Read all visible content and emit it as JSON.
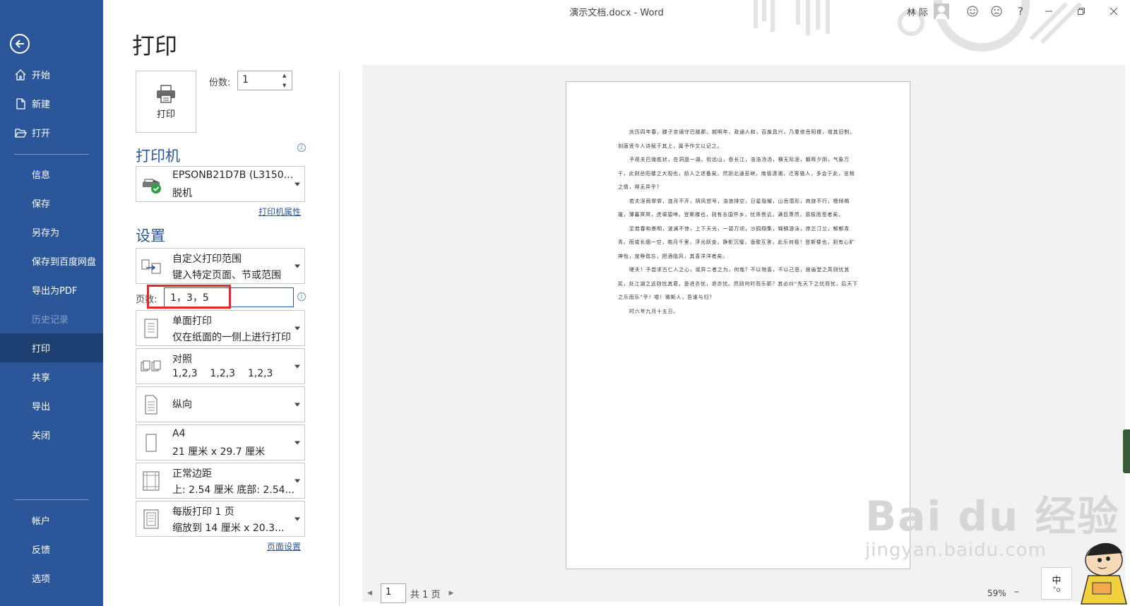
{
  "window": {
    "doc_title": "演示文档.docx  -  Word",
    "user_name": "林 际",
    "help_label": "?",
    "colors": {
      "sidebar": "#2b579a",
      "sidebar_active": "#1e3f72",
      "accent": "#2b579a",
      "highlight": "#e6262d"
    }
  },
  "sidebar": {
    "items": [
      {
        "label": "开始",
        "icon": "home-icon"
      },
      {
        "label": "新建",
        "icon": "new-document-icon"
      },
      {
        "label": "打开",
        "icon": "folder-open-icon"
      },
      {
        "label": "信息"
      },
      {
        "label": "保存"
      },
      {
        "label": "另存为"
      },
      {
        "label": "保存到百度网盘"
      },
      {
        "label": "导出为PDF"
      },
      {
        "label": "历史记录",
        "disabled": true
      },
      {
        "label": "打印",
        "active": true
      },
      {
        "label": "共享"
      },
      {
        "label": "导出"
      },
      {
        "label": "关闭"
      },
      {
        "label": "帐户"
      },
      {
        "label": "反馈"
      },
      {
        "label": "选项"
      }
    ]
  },
  "print": {
    "title": "打印",
    "button_label": "打印",
    "copies_label": "份数:",
    "copies_value": "1"
  },
  "printer": {
    "section_title": "打印机",
    "name": "EPSONB21D7B (L3150...",
    "status": "脱机",
    "properties_link": "打印机属性"
  },
  "settings": {
    "section_title": "设置",
    "range": {
      "line1": "自定义打印范围",
      "line2": "键入特定页面、节或范围"
    },
    "pages_label": "页数:",
    "pages_value": "1，3，5",
    "sides": {
      "line1": "单面打印",
      "line2": "仅在纸面的一侧上进行打印"
    },
    "collate": {
      "line1": "对照",
      "line2": "1,2,3    1,2,3    1,2,3"
    },
    "orientation": {
      "line1": "纵向"
    },
    "paper": {
      "line1": "A4",
      "line2": "21 厘米 x 29.7 厘米"
    },
    "margins": {
      "line1": "正常边距",
      "line2": "上: 2.54 厘米 底部: 2.54..."
    },
    "pages_per_sheet": {
      "line1": "每版打印 1 页",
      "line2": "缩放到 14 厘米 x 20.3..."
    },
    "page_setup_link": "页面设置"
  },
  "preview": {
    "paragraphs": [
      "庆历四年春，滕子京谪守巴陵郡。越明年，政通人和，百废具兴，乃重修岳阳楼，增其旧制，刻唐贤今人诗赋于其上，属予作文以记之。",
      "予观夫巴陵胜状，在洞庭一湖。衔远山，吞长江，浩浩汤汤，横无际涯，朝晖夕阴，气象万千，此则岳阳楼之大观也，前人之述备矣。然则北通巫峡，南极潇湘，迁客骚人，多会于此，览物之情，得无异乎？",
      "若夫淫雨霏霏，连月不开，阴风怒号，浊浪排空，日星隐耀，山岳潜形，商旅不行，樯倾楫摧，薄暮冥冥，虎啸猿啼。登斯楼也，则有去国怀乡，忧谗畏讥，满目萧然，感极而悲者矣。",
      "至若春和景明，波澜不惊，上下天光，一碧万顷，沙鸥翔集，锦鳞游泳，岸芷汀兰，郁郁青青。而或长烟一空，皓月千里，浮光跃金，静影沉璧，渔歌互答，此乐何极！登斯楼也，则有心旷神怡，宠辱偕忘，把酒临风，其喜洋洋者矣。",
      "嗟夫！予尝求古仁人之心，或异二者之为，何哉？不以物喜，不以己悲，居庙堂之高则忧其民，处江湖之远则忧其君。是进亦忧，退亦忧。然则何时而乐耶？其必曰“先天下之忧而忧，后天下之乐而乐”乎！噫！微斯人，吾谁与归？",
      "时六年九月十五日。"
    ],
    "current_page": "1",
    "total_pages": "共 1 页",
    "zoom": "59%",
    "zoom_minus": "–"
  },
  "watermark": {
    "big": "Bai du 经验",
    "small": "jingyan.baidu.com"
  },
  "ime": {
    "label": "中",
    "sub": "°o"
  }
}
